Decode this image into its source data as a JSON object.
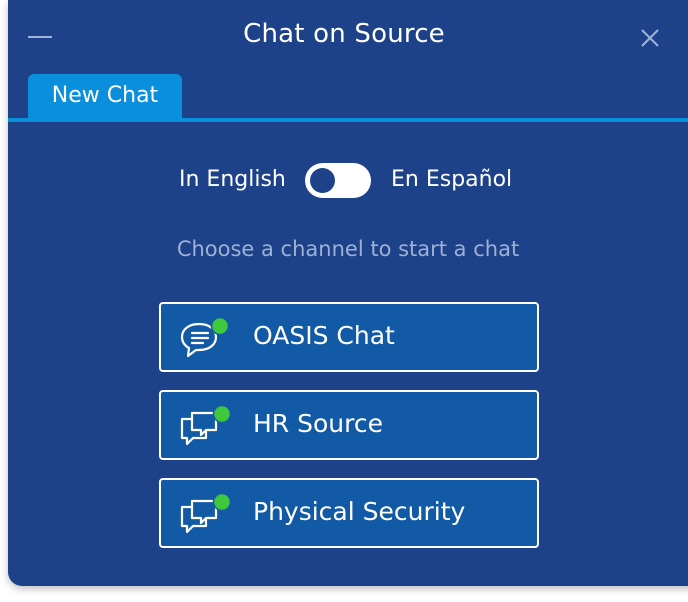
{
  "window": {
    "title": "Chat on Source",
    "minimize_icon": "minimize-icon",
    "close_icon": "close-icon"
  },
  "tabs": [
    {
      "label": "New Chat",
      "active": true
    }
  ],
  "language": {
    "left_label": "In English",
    "right_label": "En Español",
    "selected": "In English"
  },
  "prompt": "Choose a channel to start a chat",
  "channels": [
    {
      "label": "OASIS Chat",
      "icon": "chat-bubble-lines-icon",
      "status": "online"
    },
    {
      "label": "HR Source",
      "icon": "chat-bubbles-icon",
      "status": "online"
    },
    {
      "label": "Physical Security",
      "icon": "chat-bubbles-icon",
      "status": "online"
    }
  ],
  "colors": {
    "panel": "#1d4289",
    "accent": "#0a8fdc",
    "button": "#125aa6",
    "online": "#3ec93c",
    "prompt_text": "#9fb0d3"
  }
}
